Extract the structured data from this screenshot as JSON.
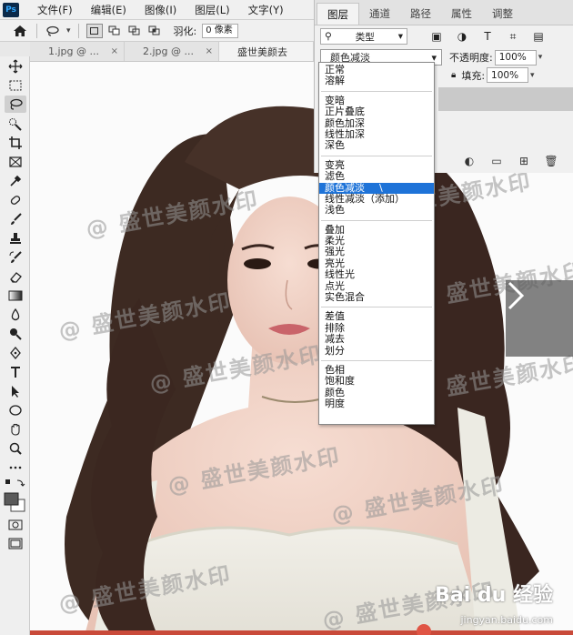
{
  "app": {
    "logo": "Ps"
  },
  "menu": [
    "文件(F)",
    "编辑(E)",
    "图像(I)",
    "图层(L)",
    "文字(Y)"
  ],
  "options": {
    "feather_label": "羽化:",
    "feather_value": "0 像素"
  },
  "tabs": [
    {
      "label": "1.jpg @ ...",
      "close": "×"
    },
    {
      "label": "2.jpg @ ...",
      "close": "×"
    },
    {
      "label": "盛世美颜去",
      "close": ""
    }
  ],
  "layers_panel": {
    "tabs": [
      "图层",
      "通道",
      "路径",
      "属性",
      "调整"
    ],
    "filter_label": "类型",
    "blend_mode": "颜色减淡",
    "opacity_label": "不透明度:",
    "opacity_value": "100%",
    "fill_label": "填充:",
    "fill_value": "100%"
  },
  "blend_dropdown": {
    "groups": [
      [
        "正常",
        "溶解"
      ],
      [
        "变暗",
        "正片叠底",
        "颜色加深",
        "线性加深",
        "深色"
      ],
      [
        "变亮",
        "滤色",
        "颜色减淡",
        "线性减淡（添加）",
        "浅色"
      ],
      [
        "叠加",
        "柔光",
        "强光",
        "亮光",
        "线性光",
        "点光",
        "实色混合"
      ],
      [
        "差值",
        "排除",
        "减去",
        "划分"
      ],
      [
        "色相",
        "饱和度",
        "颜色",
        "明度"
      ]
    ],
    "selected": "颜色减淡",
    "hover_tag": "\\"
  },
  "watermarks": [
    "@ 盛世美颜水印",
    "@ 盛世美颜水印",
    "@ 盛世美颜水印",
    "@ 盛世美颜水印",
    "@ 盛世美颜水印",
    "@ 盛世美颜水印",
    "@ 盛世美颜水印",
    "@ 盛世美颜水印",
    "@ 盛世美颜水印",
    "@ 盛世美颜水印"
  ],
  "baidu": {
    "logo": "Bai du 经验",
    "url": "jingyan.baidu.com"
  },
  "colors": {
    "selection": "#1e73d8",
    "ps_dark": "#0b2a4a",
    "ps_blue": "#31a8ff"
  }
}
